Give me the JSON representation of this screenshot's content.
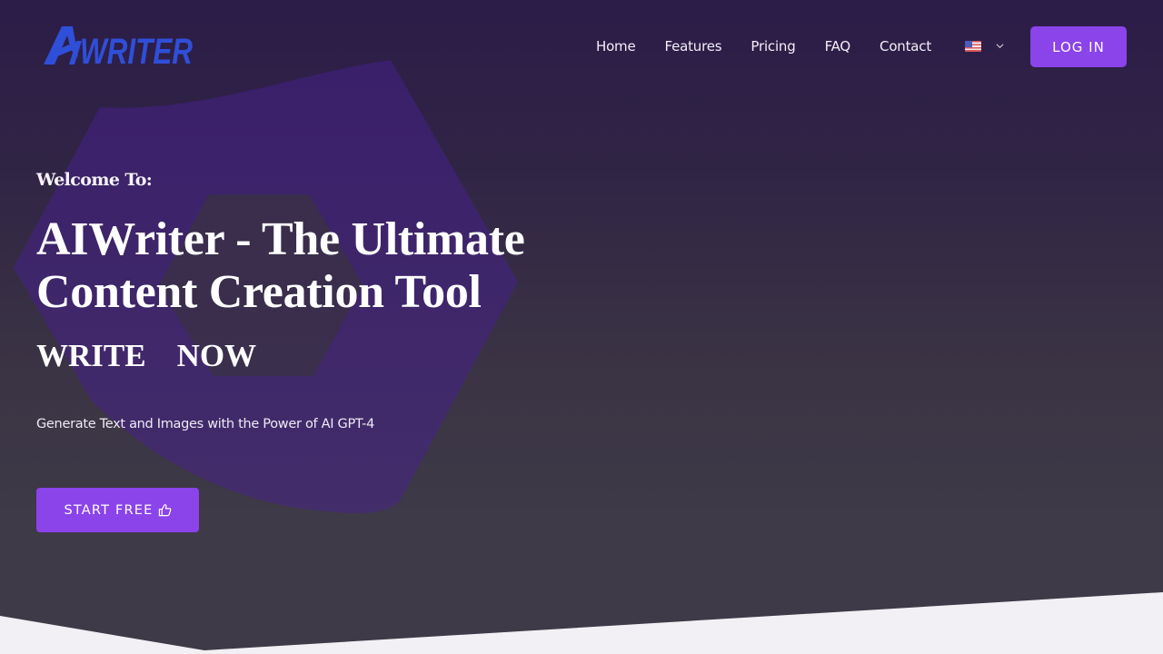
{
  "header": {
    "logo_text": "AIWRITER",
    "nav": [
      {
        "label": "Home"
      },
      {
        "label": "Features"
      },
      {
        "label": "Pricing"
      },
      {
        "label": "FAQ"
      },
      {
        "label": "Contact"
      }
    ],
    "language": {
      "icon": "us-flag-icon",
      "selected": "English (US)"
    },
    "login_label": "LOG IN"
  },
  "hero": {
    "welcome": "Welcome To:",
    "title": "AIWriter - The Ultimate Content Creation Tool",
    "typed_words": [
      "WRITE",
      "NOW"
    ],
    "subtitle": "Generate Text and Images with the Power of AI GPT-4",
    "cta_label": "START FREE",
    "cta_icon": "thumbs-up-icon"
  },
  "colors": {
    "accent": "#8b43ea",
    "logo": "#2f4fd9",
    "background_top": "#2c1c48",
    "background_bottom": "#3e3a47",
    "hexagon": "#3b2468",
    "footer_band": "#f2f0f5"
  }
}
